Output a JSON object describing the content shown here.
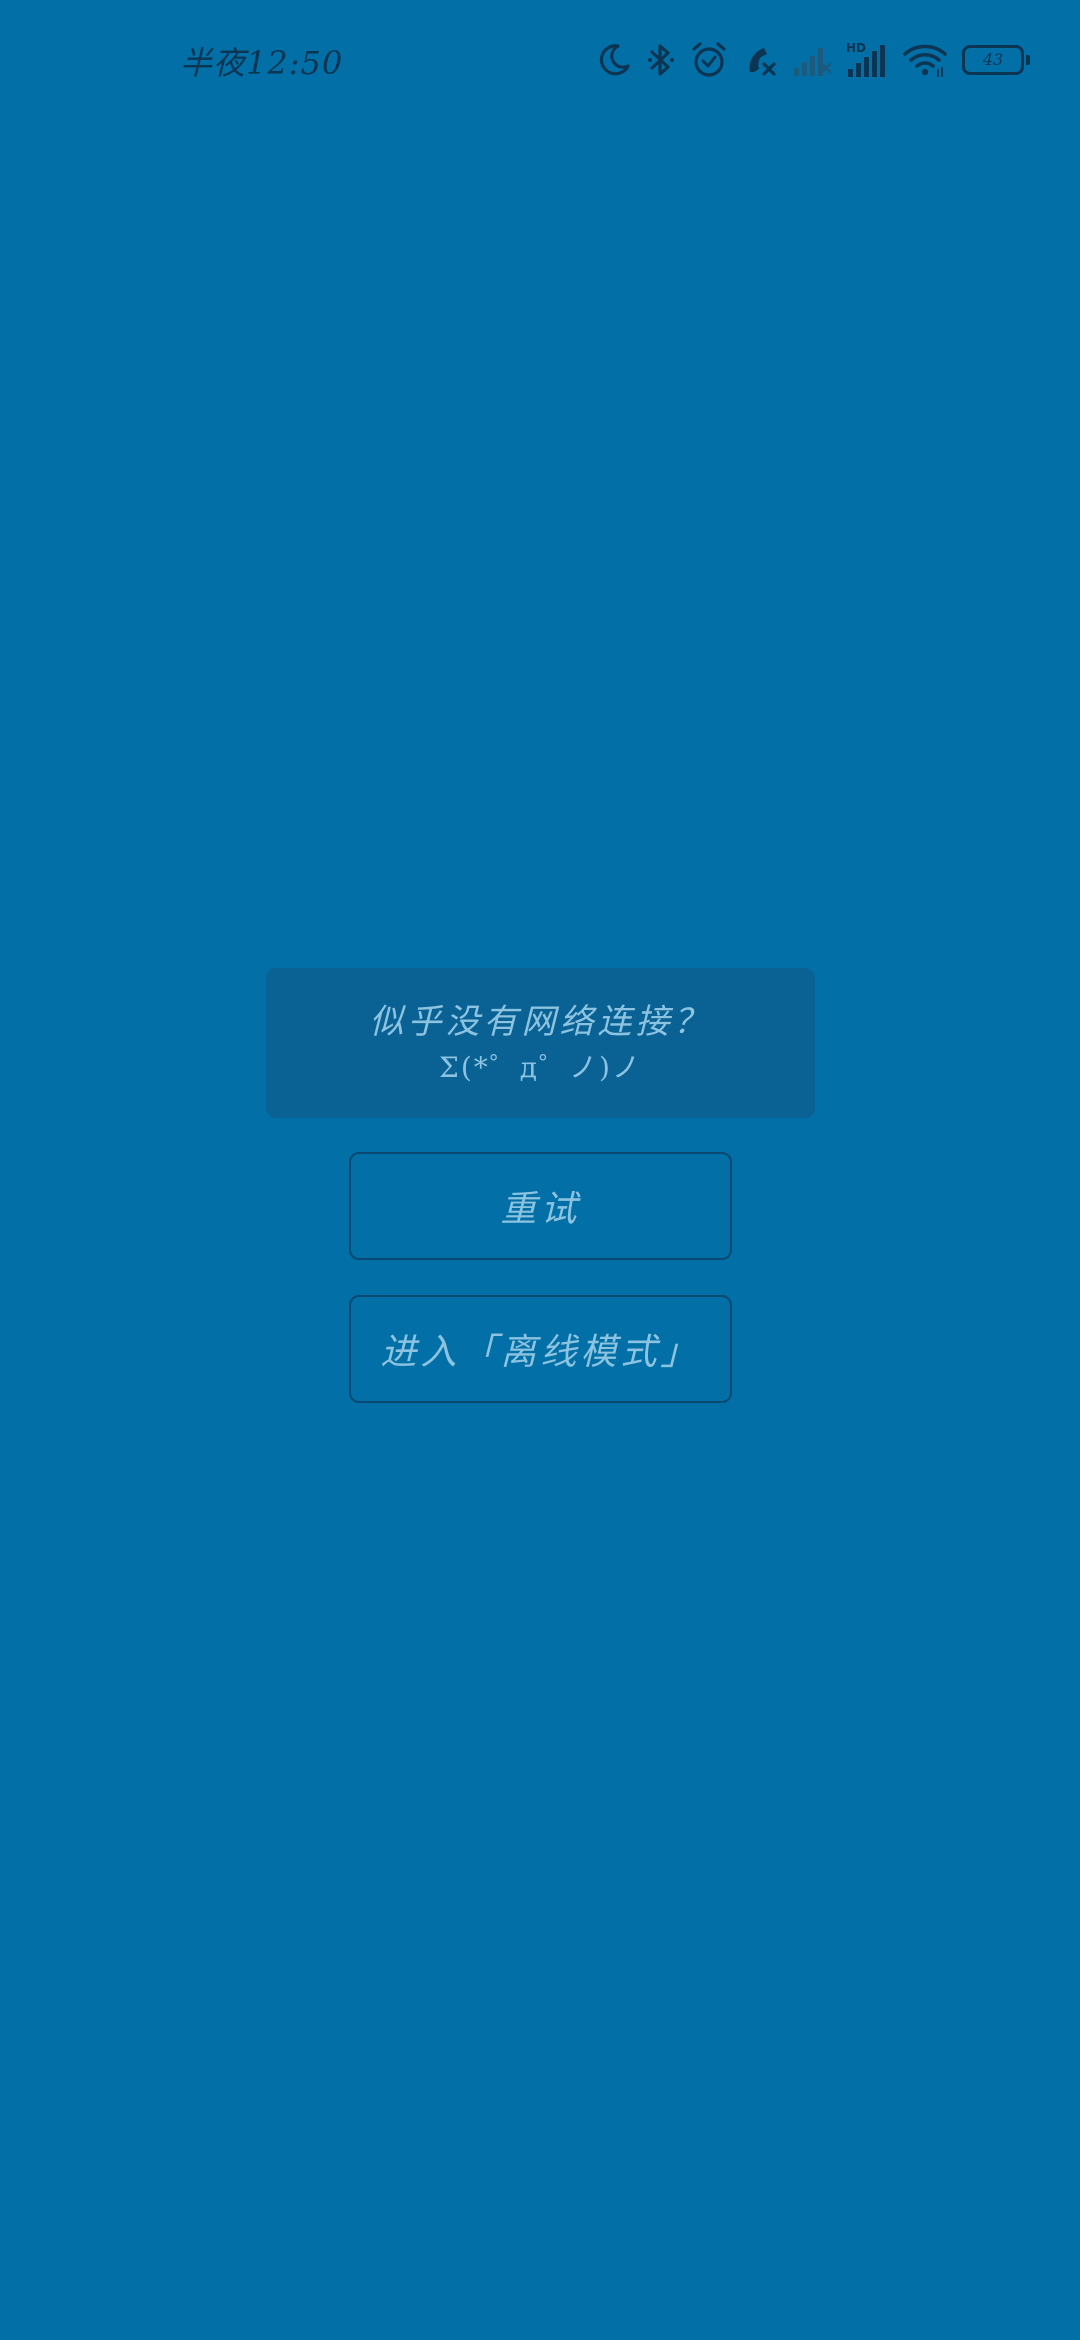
{
  "status_bar": {
    "time": "半夜12:50",
    "battery_level": "43",
    "icons": [
      "moon-icon",
      "bluetooth-icon",
      "alarm-icon",
      "missed-call-icon",
      "signal-sim2-icon",
      "hd-signal-icon",
      "wifi-icon",
      "battery-icon"
    ],
    "icon_color": "#0b3552"
  },
  "main": {
    "message_title": "似乎没有网络连接？",
    "message_emoticon": "Σ(*゜д゜ノ)ノ",
    "retry_label": "重试",
    "offline_label": "进入「离线模式」"
  },
  "colors": {
    "background": "#026fa6",
    "message_box": "#0a6294",
    "text": "#8cc3e0",
    "button_border": "#0a4a72"
  }
}
